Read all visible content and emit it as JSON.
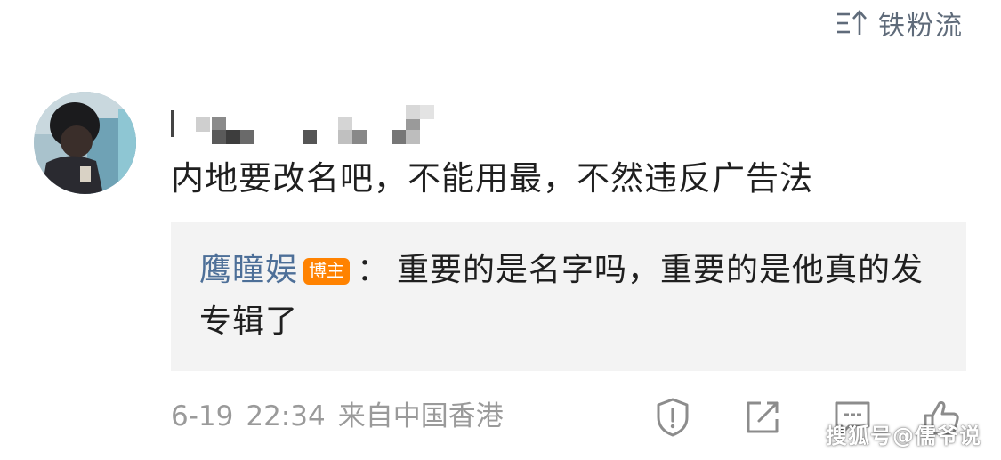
{
  "sort": {
    "label": "铁粉流",
    "icon": "sort-icon"
  },
  "comment": {
    "avatar_icon": "user-avatar",
    "username": "",
    "text": "内地要改名吧，不能用最，不然违反广告法"
  },
  "reply": {
    "author": "鹰瞳娱",
    "badge": "博主",
    "separator": "：",
    "text": "重要的是名字吗，重要的是他真的发专辑了"
  },
  "meta": {
    "date": "6-19",
    "time": "22:34",
    "source": "来自中国香港"
  },
  "actions": {
    "report_icon": "report-shield-icon",
    "share_icon": "share-icon",
    "comment_icon": "comment-icon",
    "like_icon": "like-icon"
  },
  "watermark": "搜狐号@儒爷说",
  "colors": {
    "author_link": "#4d6f98",
    "badge": "#ff8200",
    "reply_bg": "#f3f3f3",
    "meta_text": "#9a9a9a",
    "icon_gray": "#5f6b7a"
  }
}
